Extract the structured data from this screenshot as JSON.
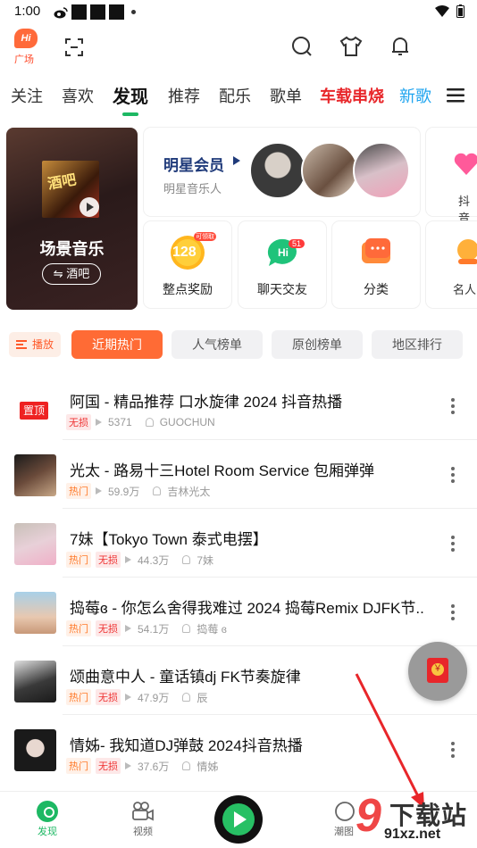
{
  "status": {
    "time": "1:00"
  },
  "header": {
    "plaza_label": "广场",
    "plaza_badge": "Hi"
  },
  "tabs": [
    {
      "label": "关注"
    },
    {
      "label": "喜欢"
    },
    {
      "label": "发现"
    },
    {
      "label": "推荐"
    },
    {
      "label": "配乐"
    },
    {
      "label": "歌单"
    },
    {
      "label": "车载串烧"
    },
    {
      "label": "新歌"
    }
  ],
  "banner": {
    "scene": {
      "title": "场景音乐",
      "tag": "⇋ 酒吧",
      "cover_text": "酒吧"
    },
    "star": {
      "title": "明星会员",
      "subtitle": "明星音乐人"
    },
    "edge_top_label": "抖音",
    "edge_bottom_label": "名人",
    "features": [
      {
        "label": "整点奖励",
        "badge": "128",
        "badge_small": "可领取"
      },
      {
        "label": "聊天交友",
        "badge": "Hi",
        "count": "51"
      },
      {
        "label": "分类"
      }
    ]
  },
  "filters": {
    "play_label": "播放",
    "chips": [
      "近期热门",
      "人气榜单",
      "原创榜单",
      "地区排行"
    ]
  },
  "songs": [
    {
      "title": "阿国 - 精品推荐 口水旋律 2024 抖音热播",
      "pinned": "置顶",
      "badges": [
        "无损"
      ],
      "plays": "5371",
      "artist": "GUOCHUN"
    },
    {
      "title": "光太 - 路易十三Hotel Room Service 包厢弹弹",
      "badges": [
        "热门"
      ],
      "plays": "59.9万",
      "artist": "吉林光太"
    },
    {
      "title": "7妹【Tokyo Town 泰式电摆】",
      "badges": [
        "热门",
        "无损"
      ],
      "plays": "44.3万",
      "artist": "7妹"
    },
    {
      "title": "捣莓ɞ - 你怎么舍得我难过 2024 捣莓Remix DJFK节..",
      "badges": [
        "热门",
        "无损"
      ],
      "plays": "54.1万",
      "artist": "捣莓  ɞ"
    },
    {
      "title": "颂曲意中人 - 童话镇dj FK节奏旋律",
      "badges": [
        "热门",
        "无损"
      ],
      "plays": "47.9万",
      "artist": "辰"
    },
    {
      "title": "情姊- 我知道DJ弹鼓 2024抖音热播",
      "badges": [
        "热门",
        "无损"
      ],
      "plays": "37.6万",
      "artist": "情姊"
    }
  ],
  "bottom_nav": {
    "discover": "发现",
    "video": "视频",
    "trend": "潮图"
  },
  "watermark": {
    "big": "下载站",
    "small": "91xz.net",
    "nine": "9"
  },
  "colors": {
    "accent_green": "#1db863",
    "accent_orange": "#ff6b35",
    "red_tab": "#e8272b",
    "blue_tab": "#1fa4ef"
  }
}
